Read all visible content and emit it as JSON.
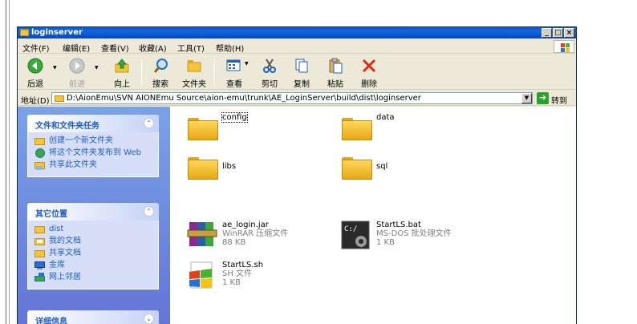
{
  "window": {
    "title": "loginserver",
    "controls": [
      "_",
      "□",
      "×"
    ]
  },
  "menubar": {
    "items": [
      "文件(F)",
      "编辑(E)",
      "查看(V)",
      "收藏(A)",
      "工具(T)",
      "帮助(H)"
    ]
  },
  "toolbar": {
    "back": "后退",
    "forward": "前进",
    "up": "向上",
    "search": "搜索",
    "folders": "文件夹",
    "views": "查看",
    "cut": "剪切",
    "copy": "复制",
    "paste": "粘贴",
    "delete": "删除"
  },
  "address": {
    "label": "地址(D)",
    "path": "D:\\AionEmu\\SVN AIONEmu Source\\aion-emu\\trunk\\AE_LoginServer\\build\\dist\\loginserver",
    "go": "转到"
  },
  "taskpane": {
    "tasks": {
      "title": "文件和文件夹任务",
      "items": [
        "创建一个新文件夹",
        "将这个文件夹发布到 Web",
        "共享此文件夹"
      ]
    },
    "other": {
      "title": "其它位置",
      "items": [
        "dist",
        "我的文档",
        "共享文档",
        "金库",
        "网上邻居"
      ]
    },
    "details": {
      "title": "详细信息"
    }
  },
  "files": [
    {
      "name": "config"
    },
    {
      "name": "data"
    },
    {
      "name": "libs"
    },
    {
      "name": "sql"
    },
    {
      "name": "ae_login.jar",
      "type": "WinRAR 压缩文件",
      "size": "88 KB"
    },
    {
      "name": "StartLS.bat",
      "type": "MS-DOS 批处理文件",
      "size": "1 KB"
    },
    {
      "name": "StartLS.sh",
      "type": "SH 文件",
      "size": "1 KB"
    }
  ],
  "colors": {
    "titlebar": "#0a5dd9",
    "taskpane": "#6d8ddf",
    "panel_title": "#215dc6",
    "folder": "#f6c33a"
  }
}
